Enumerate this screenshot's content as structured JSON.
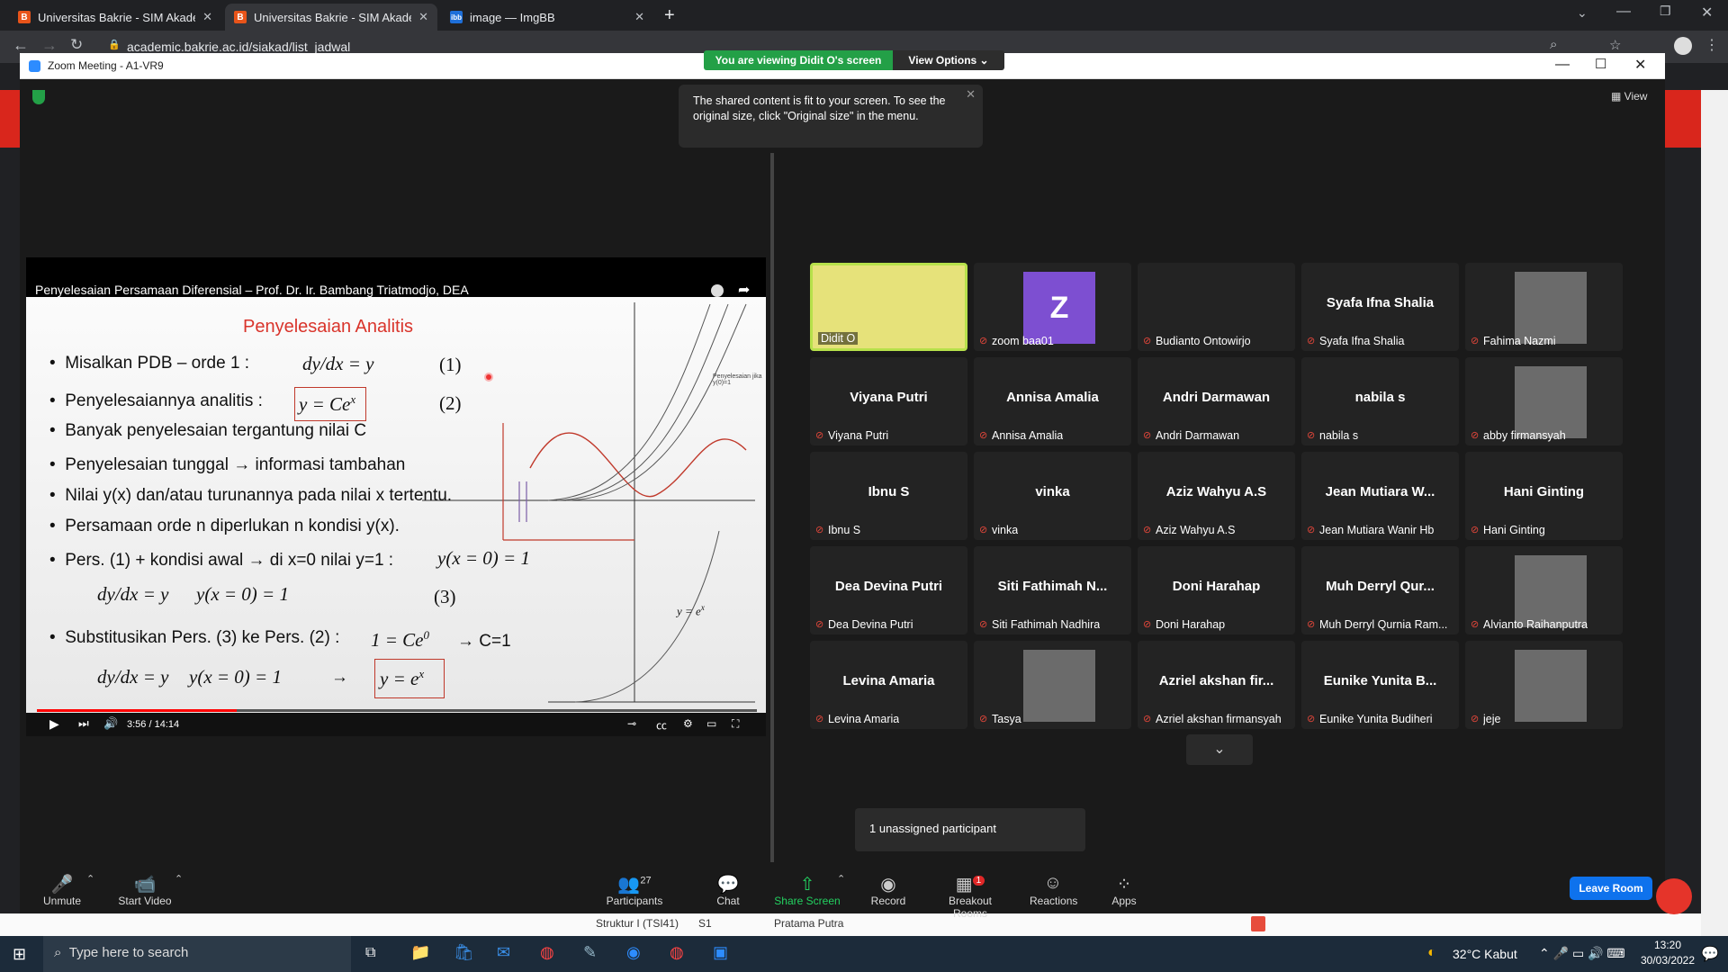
{
  "browser": {
    "tabs": [
      {
        "title": "Universitas Bakrie - SIM Akadem",
        "icon": "B"
      },
      {
        "title": "Universitas Bakrie - SIM Akadem",
        "icon": "B"
      },
      {
        "title": "image — ImgBB",
        "icon": "ibb"
      }
    ],
    "url": "academic.bakrie.ac.id/siakad/list_jadwal"
  },
  "zoom": {
    "window_title": "Zoom Meeting - A1-VR9",
    "view_banner": "You are viewing Didit O's screen",
    "view_options": "View Options",
    "view_label": "View",
    "tooltip": "The shared content is fit to your screen. To see the original size, click \"Original size\" in the menu.",
    "unassigned": "1 unassigned participant",
    "leave_room": "Leave Room"
  },
  "video": {
    "title": "Penyelesaian Persamaan Diferensial – Prof. Dr. Ir. Bambang Triatmodjo, DEA",
    "time": "3:56 / 14:14",
    "progress": 0.278
  },
  "slide": {
    "title": "Penyelesaian Analitis",
    "bullets": [
      "Misalkan PDB – orde 1 :",
      "Penyelesaiannya analitis :",
      "Banyak penyelesaian tergantung nilai C",
      "Penyelesaian tunggal → informasi tambahan",
      "Nilai y(x) dan/atau turunannya pada nilai x tertentu.",
      "Persamaan orde n diperlukan n kondisi y(x).",
      "Pers. (1) + kondisi awal  →  di x=0 nilai y=1 :",
      "Substitusikan Pers. (3) ke Pers. (2) :"
    ],
    "eq1": "dy/dx = y",
    "eq1_num": "(1)",
    "eq2": "y = Ce",
    "eq2_num": "(2)",
    "eq_init": "y(x = 0) = 1",
    "eq3_num": "(3)",
    "eq_sub": "1 = Ce",
    "eq_c": "→ C=1",
    "eq_final": "y = e",
    "graph_label": "y = e",
    "graph_note": "Penyelesaian jika y(0)=1"
  },
  "participants": [
    {
      "name": "Didit O",
      "type": "video"
    },
    {
      "name": "zoom baa01",
      "type": "letter",
      "letter": "Z"
    },
    {
      "name": "Budianto Ontowirjo",
      "type": "blank"
    },
    {
      "name": "Syafa Ifna Shalia",
      "big": "Syafa Ifna Shalia",
      "type": "text"
    },
    {
      "name": "Fahima Nazmi",
      "type": "photo"
    },
    {
      "name": "Viyana Putri",
      "big": "Viyana Putri",
      "type": "text"
    },
    {
      "name": "Annisa Amalia",
      "big": "Annisa Amalia",
      "type": "text"
    },
    {
      "name": "Andri Darmawan",
      "big": "Andri Darmawan",
      "type": "text"
    },
    {
      "name": "nabila s",
      "big": "nabila s",
      "type": "text"
    },
    {
      "name": "abby firmansyah",
      "type": "photo"
    },
    {
      "name": "Ibnu S",
      "big": "Ibnu S",
      "type": "text"
    },
    {
      "name": "vinka",
      "big": "vinka",
      "type": "text"
    },
    {
      "name": "Aziz Wahyu A.S",
      "big": "Aziz Wahyu A.S",
      "type": "text"
    },
    {
      "name": "Jean Mutiara Wanir Hb",
      "big": "Jean Mutiara W...",
      "type": "text"
    },
    {
      "name": "Hani Ginting",
      "big": "Hani Ginting",
      "type": "text"
    },
    {
      "name": "Dea Devina Putri",
      "big": "Dea Devina Putri",
      "type": "text"
    },
    {
      "name": "Siti Fathimah Nadhira",
      "big": "Siti Fathimah N...",
      "type": "text"
    },
    {
      "name": "Doni Harahap",
      "big": "Doni Harahap",
      "type": "text"
    },
    {
      "name": "Muh Derryl Qurnia Ram...",
      "big": "Muh Derryl Qur...",
      "type": "text"
    },
    {
      "name": "Alvianto Raihanputra",
      "type": "photo"
    },
    {
      "name": "Levina Amaria",
      "big": "Levina Amaria",
      "type": "text"
    },
    {
      "name": "Tasya",
      "type": "photo"
    },
    {
      "name": "Azriel akshan firmansyah",
      "big": "Azriel akshan fir...",
      "type": "text"
    },
    {
      "name": "Eunike Yunita Budiheri",
      "big": "Eunike Yunita B...",
      "type": "text"
    },
    {
      "name": "jeje",
      "type": "photo"
    }
  ],
  "toolbar": {
    "unmute": "Unmute",
    "start_video": "Start Video",
    "participants": "Participants",
    "participants_count": "27",
    "chat": "Chat",
    "share_screen": "Share Screen",
    "record": "Record",
    "breakout_rooms": "Breakout Rooms",
    "breakout_badge": "1",
    "reactions": "Reactions",
    "apps": "Apps"
  },
  "behind_table": {
    "cells": [
      "Struktur I (TSI41)",
      "S1",
      "Pratama Putra"
    ]
  },
  "taskbar": {
    "search_placeholder": "Type here to search",
    "weather": "32°C  Kabut",
    "time": "13:20",
    "date": "30/03/2022"
  },
  "colors": {
    "accent_green": "#23a047",
    "slide_red": "#d9342b",
    "leave_blue": "#0e72ed",
    "taskbar": "#1c2b3a"
  }
}
